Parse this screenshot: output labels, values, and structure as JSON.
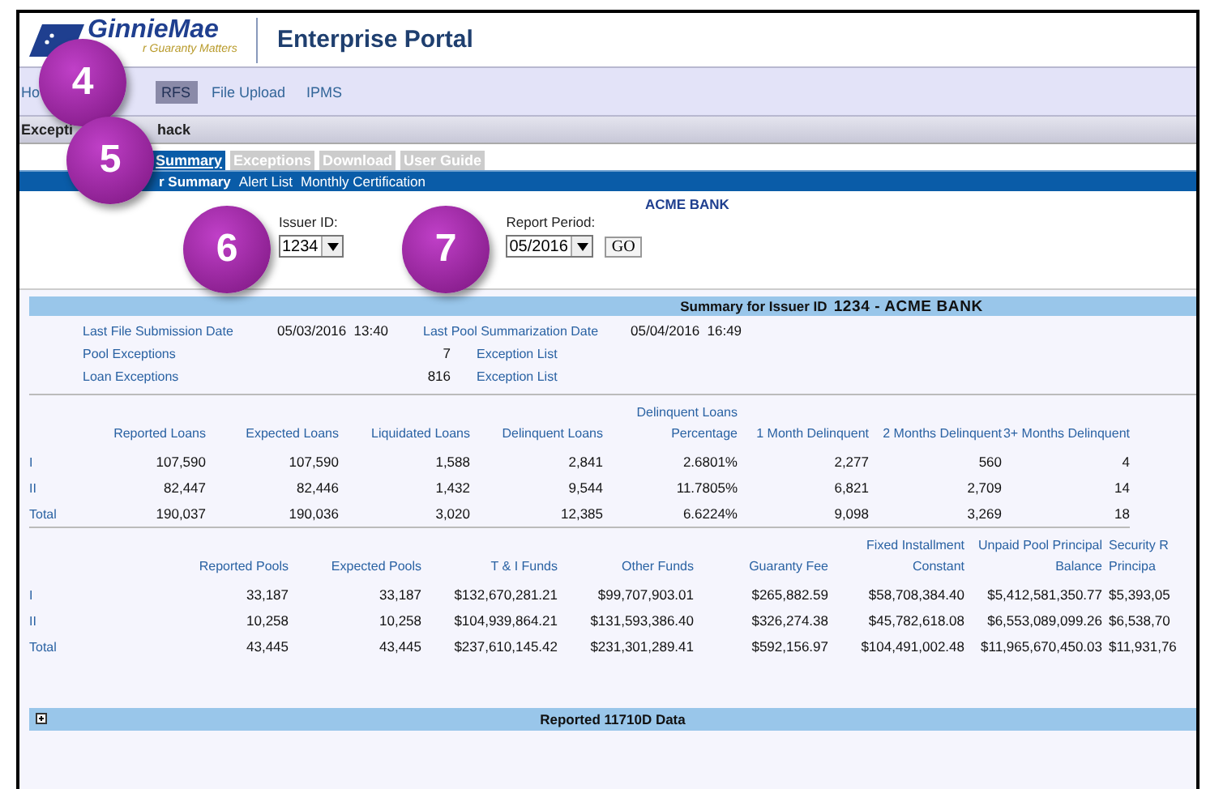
{
  "header": {
    "logo": "GinnieMae",
    "tagline": "r Guaranty Matters",
    "title": "Enterprise Portal"
  },
  "nav": [
    {
      "label": "Ho",
      "selected": false
    },
    {
      "label": "RFS",
      "selected": true
    },
    {
      "label": "File Upload",
      "selected": false
    },
    {
      "label": "IPMS",
      "selected": false
    }
  ],
  "section_title": [
    "Excepti",
    "hack"
  ],
  "tabs": [
    {
      "label": "Summary",
      "selected": true
    },
    {
      "label": "Exceptions",
      "selected": false
    },
    {
      "label": "Download",
      "selected": false
    },
    {
      "label": "User Guide",
      "selected": false
    }
  ],
  "sub_nav": [
    {
      "label": "r Summary",
      "selected": true
    },
    {
      "label": "Alert List",
      "selected": false
    },
    {
      "label": "Monthly Certification",
      "selected": false
    }
  ],
  "bank_name": "ACME BANK",
  "filters": {
    "issuer_label": "Issuer ID:",
    "issuer_value": "1234",
    "period_label": "Report Period:",
    "period_value": "05/2016",
    "go": "GO"
  },
  "summary": {
    "title": "Summary for Issuer ID",
    "issuer": "1234 - ACME BANK",
    "last_file_label": "Last File Submission Date",
    "last_file_value": "05/03/2016  13:40",
    "last_pool_label": "Last Pool Summarization Date",
    "last_pool_value": "05/04/2016  16:49",
    "exceptions": [
      {
        "label": "Pool Exceptions",
        "count": "7",
        "link": "Exception List"
      },
      {
        "label": "Loan Exceptions",
        "count": "816",
        "link": "Exception List"
      }
    ]
  },
  "loan_table": {
    "columns": [
      "Reported Loans",
      "Expected Loans",
      "Liquidated Loans",
      "Delinquent Loans",
      "Delinquent Loans Percentage",
      "1 Month Delinquent",
      "2 Months Delinquent",
      "3+ Months Delinquent"
    ],
    "rows": [
      {
        "label": "I",
        "cells": [
          "107,590",
          "107,590",
          "1,588",
          "2,841",
          "2.6801%",
          "2,277",
          "560",
          "4"
        ]
      },
      {
        "label": "II",
        "cells": [
          "82,447",
          "82,446",
          "1,432",
          "9,544",
          "11.7805%",
          "6,821",
          "2,709",
          "14"
        ]
      },
      {
        "label": "Total",
        "cells": [
          "190,037",
          "190,036",
          "3,020",
          "12,385",
          "6.6224%",
          "9,098",
          "3,269",
          "18"
        ]
      }
    ]
  },
  "pool_table": {
    "columns": [
      "Reported Pools",
      "Expected Pools",
      "T & I Funds",
      "Other Funds",
      "Guaranty Fee",
      "Fixed Installment Constant",
      "Unpaid Pool Principal Balance",
      "Security R Principa"
    ],
    "rows": [
      {
        "label": "I",
        "cells": [
          "33,187",
          "33,187",
          "$132,670,281.21",
          "$99,707,903.01",
          "$265,882.59",
          "$58,708,384.40",
          "$5,412,581,350.77",
          "$5,393,05"
        ]
      },
      {
        "label": "II",
        "cells": [
          "10,258",
          "10,258",
          "$104,939,864.21",
          "$131,593,386.40",
          "$326,274.38",
          "$45,782,618.08",
          "$6,553,089,099.26",
          "$6,538,70"
        ]
      },
      {
        "label": "Total",
        "cells": [
          "43,445",
          "43,445",
          "$237,610,145.42",
          "$231,301,289.41",
          "$592,156.97",
          "$104,491,002.48",
          "$11,965,670,450.03",
          "$11,931,76"
        ]
      }
    ]
  },
  "reported_section": {
    "title": "Reported 11710D Data",
    "expanded": false
  },
  "callouts": [
    "4",
    "5",
    "6",
    "7"
  ]
}
